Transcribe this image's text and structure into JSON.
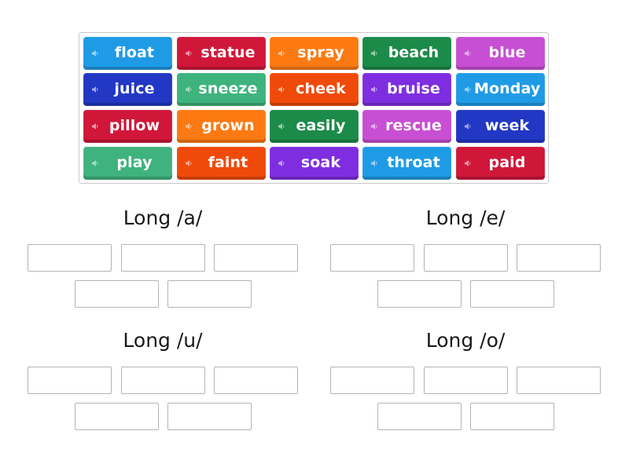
{
  "word_bank": {
    "tiles": [
      {
        "word": "float",
        "color": "#1f9be6"
      },
      {
        "word": "statue",
        "color": "#d0173a"
      },
      {
        "word": "spray",
        "color": "#fd7a12"
      },
      {
        "word": "beach",
        "color": "#1c8a48"
      },
      {
        "word": "blue",
        "color": "#c74fd3"
      },
      {
        "word": "juice",
        "color": "#2237c4"
      },
      {
        "word": "sneeze",
        "color": "#3fb37d"
      },
      {
        "word": "cheek",
        "color": "#f04a0a"
      },
      {
        "word": "bruise",
        "color": "#7e2ee0"
      },
      {
        "word": "Monday",
        "color": "#1f9be6"
      },
      {
        "word": "pillow",
        "color": "#d0173a"
      },
      {
        "word": "grown",
        "color": "#fd7a12"
      },
      {
        "word": "easily",
        "color": "#1c8a48"
      },
      {
        "word": "rescue",
        "color": "#c74fd3"
      },
      {
        "word": "week",
        "color": "#2237c4"
      },
      {
        "word": "play",
        "color": "#3fb37d"
      },
      {
        "word": "faint",
        "color": "#f04a0a"
      },
      {
        "word": "soak",
        "color": "#7e2ee0"
      },
      {
        "word": "throat",
        "color": "#1f9be6"
      },
      {
        "word": "paid",
        "color": "#d0173a"
      }
    ],
    "icon": "speaker-icon"
  },
  "groups": [
    {
      "title": "Long /a/",
      "slots": 5
    },
    {
      "title": "Long /e/",
      "slots": 5
    },
    {
      "title": "Long /u/",
      "slots": 5
    },
    {
      "title": "Long /o/",
      "slots": 5
    }
  ]
}
